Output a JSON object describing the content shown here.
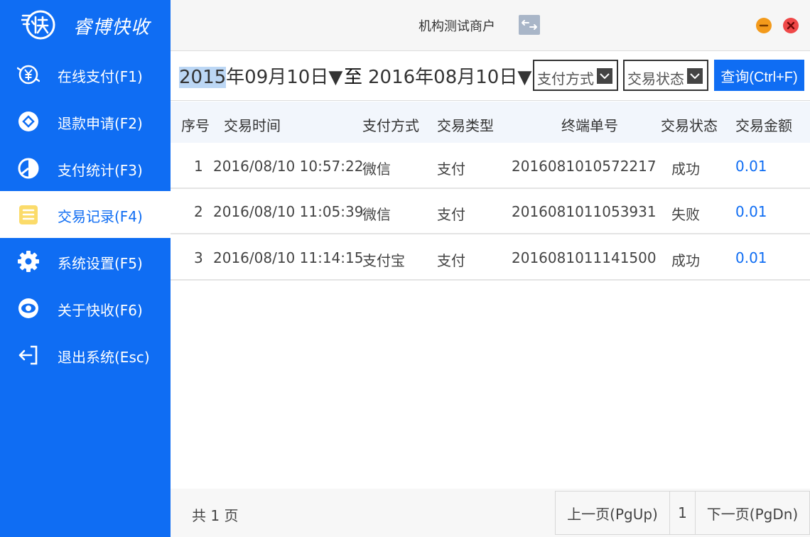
{
  "app": {
    "name": "睿博快收",
    "merchant": "机构测试商户"
  },
  "sidebar": {
    "items": [
      {
        "label": "在线支付(F1)",
        "icon": "yen-circle-icon"
      },
      {
        "label": "退款申请(F2)",
        "icon": "refund-circle-icon"
      },
      {
        "label": "支付统计(F3)",
        "icon": "pie-chart-icon"
      },
      {
        "label": "交易记录(F4)",
        "icon": "list-doc-icon",
        "active": true
      },
      {
        "label": "系统设置(F5)",
        "icon": "gear-icon"
      },
      {
        "label": "关于快收(F6)",
        "icon": "eye-icon"
      },
      {
        "label": "退出系统(Esc)",
        "icon": "exit-icon"
      }
    ]
  },
  "filter": {
    "start_year": "2015",
    "start_rest": "年09月10日",
    "separator": "至",
    "end_date": "2016年08月10日",
    "arrow": "▼",
    "pay_method": "支付方式",
    "status": "交易状态",
    "query_label": "查询(Ctrl+F)"
  },
  "table": {
    "headers": [
      "序号",
      "交易时间",
      "支付方式",
      "交易类型",
      "终端单号",
      "交易状态",
      "交易金额"
    ],
    "rows": [
      {
        "no": "1",
        "time": "2016/08/10 10:57:22",
        "pay": "微信",
        "type": "支付",
        "terminal": "2016081010572217",
        "status": "成功",
        "amount": "0.01"
      },
      {
        "no": "2",
        "time": "2016/08/10 11:05:39",
        "pay": "微信",
        "type": "支付",
        "terminal": "2016081011053931",
        "status": "失败",
        "amount": "0.01"
      },
      {
        "no": "3",
        "time": "2016/08/10 11:14:15",
        "pay": "支付宝",
        "type": "支付",
        "terminal": "2016081011141500",
        "status": "成功",
        "amount": "0.01"
      }
    ]
  },
  "footer": {
    "total": "共 1 页",
    "prev": "上一页(PgUp)",
    "page": "1",
    "next": "下一页(PgDn)"
  },
  "colors": {
    "accent": "#0f6df3",
    "minimize": "#f39a1b",
    "close": "#ef4848"
  }
}
